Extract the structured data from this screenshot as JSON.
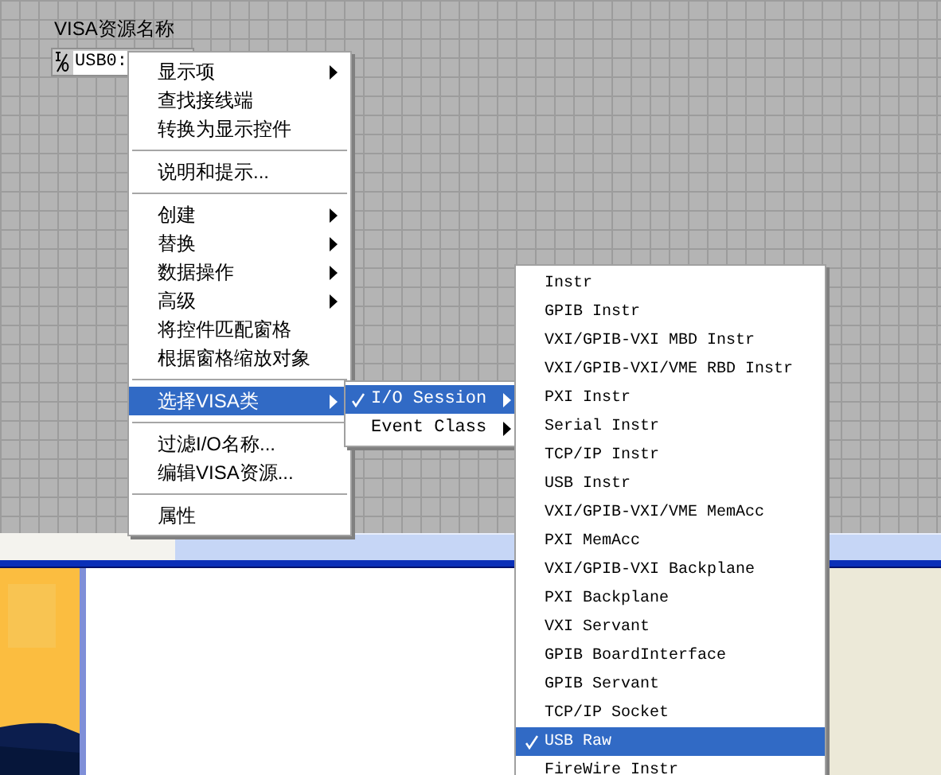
{
  "control": {
    "label": "VISA资源名称",
    "value": "USB0:"
  },
  "context_menu": {
    "items": [
      {
        "kind": "item",
        "label": "显示项",
        "submenu": true,
        "selected": false
      },
      {
        "kind": "item",
        "label": "查找接线端",
        "submenu": false,
        "selected": false
      },
      {
        "kind": "item",
        "label": "转换为显示控件",
        "submenu": false,
        "selected": false
      },
      {
        "kind": "separator"
      },
      {
        "kind": "item",
        "label": "说明和提示...",
        "submenu": false,
        "selected": false
      },
      {
        "kind": "separator"
      },
      {
        "kind": "item",
        "label": "创建",
        "submenu": true,
        "selected": false
      },
      {
        "kind": "item",
        "label": "替换",
        "submenu": true,
        "selected": false
      },
      {
        "kind": "item",
        "label": "数据操作",
        "submenu": true,
        "selected": false
      },
      {
        "kind": "item",
        "label": "高级",
        "submenu": true,
        "selected": false
      },
      {
        "kind": "item",
        "label": "将控件匹配窗格",
        "submenu": false,
        "selected": false
      },
      {
        "kind": "item",
        "label": "根据窗格缩放对象",
        "submenu": false,
        "selected": false
      },
      {
        "kind": "separator"
      },
      {
        "kind": "item",
        "label": "选择VISA类",
        "submenu": true,
        "selected": true
      },
      {
        "kind": "separator"
      },
      {
        "kind": "item",
        "label": "过滤I/O名称...",
        "submenu": false,
        "selected": false
      },
      {
        "kind": "item",
        "label": "编辑VISA资源...",
        "submenu": false,
        "selected": false
      },
      {
        "kind": "separator"
      },
      {
        "kind": "item",
        "label": "属性",
        "submenu": false,
        "selected": false
      }
    ]
  },
  "visa_class_menu": {
    "items": [
      {
        "label": "I/O Session",
        "checked": true,
        "selected": true,
        "submenu": true
      },
      {
        "label": "Event Class",
        "checked": false,
        "selected": false,
        "submenu": true
      }
    ]
  },
  "io_session_menu": {
    "items": [
      {
        "label": "Instr",
        "checked": false,
        "selected": false
      },
      {
        "label": "GPIB Instr",
        "checked": false,
        "selected": false
      },
      {
        "label": "VXI/GPIB-VXI MBD Instr",
        "checked": false,
        "selected": false
      },
      {
        "label": "VXI/GPIB-VXI/VME RBD Instr",
        "checked": false,
        "selected": false
      },
      {
        "label": "PXI Instr",
        "checked": false,
        "selected": false
      },
      {
        "label": "Serial Instr",
        "checked": false,
        "selected": false
      },
      {
        "label": "TCP/IP Instr",
        "checked": false,
        "selected": false
      },
      {
        "label": "USB Instr",
        "checked": false,
        "selected": false
      },
      {
        "label": "VXI/GPIB-VXI/VME MemAcc",
        "checked": false,
        "selected": false
      },
      {
        "label": "PXI MemAcc",
        "checked": false,
        "selected": false
      },
      {
        "label": "VXI/GPIB-VXI Backplane",
        "checked": false,
        "selected": false
      },
      {
        "label": "PXI Backplane",
        "checked": false,
        "selected": false
      },
      {
        "label": "VXI Servant",
        "checked": false,
        "selected": false
      },
      {
        "label": "GPIB BoardInterface",
        "checked": false,
        "selected": false
      },
      {
        "label": "GPIB Servant",
        "checked": false,
        "selected": false
      },
      {
        "label": "TCP/IP Socket",
        "checked": false,
        "selected": false
      },
      {
        "label": "USB Raw",
        "checked": true,
        "selected": true
      },
      {
        "label": "FireWire Instr",
        "checked": false,
        "selected": false
      }
    ]
  }
}
